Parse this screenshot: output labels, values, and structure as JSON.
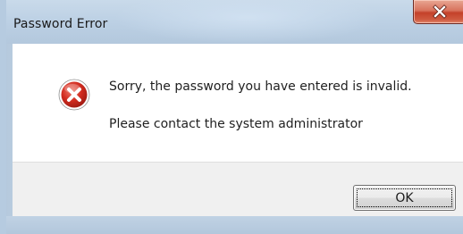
{
  "dialog": {
    "title": "Password Error",
    "close_glyph": "X",
    "message_line_1": "Sorry, the password you have entered is invalid.",
    "message_line_2": "Please contact the system administrator",
    "icon": "error-icon",
    "ok_label": "OK"
  },
  "colors": {
    "close_button_red": "#c4412a",
    "error_icon_red": "#d12b1f",
    "title_bar": "#bcd0e4",
    "footer": "#f0f0f0"
  }
}
